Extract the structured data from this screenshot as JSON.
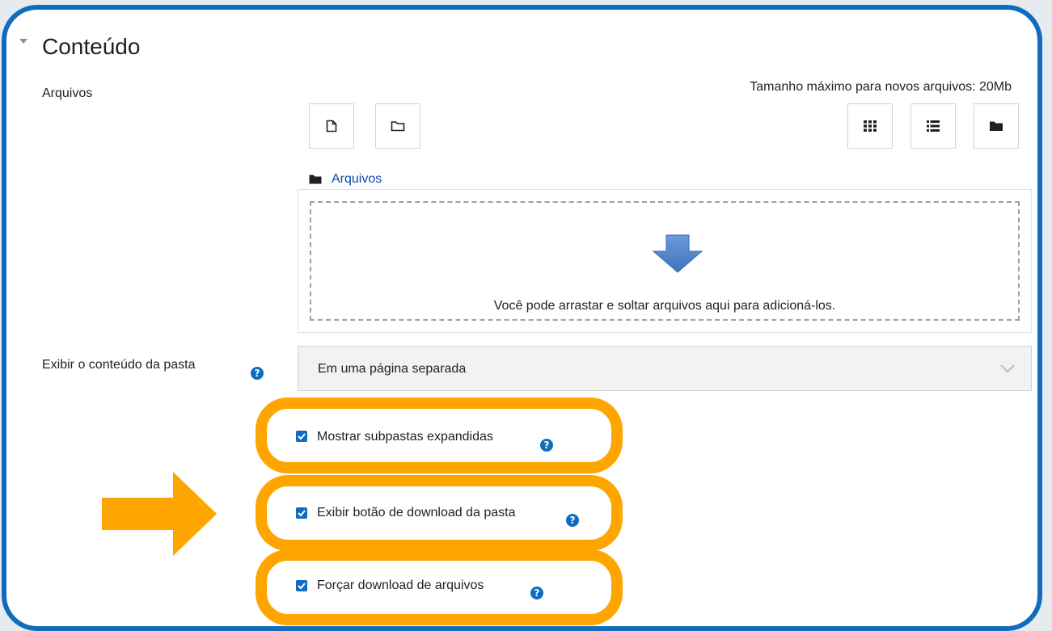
{
  "section": {
    "title": "Conteúdo"
  },
  "files": {
    "label": "Arquivos",
    "max_size": "Tamanho máximo para novos arquivos: 20Mb",
    "path_label": "Arquivos",
    "drop_text": "Você pode arrastar e soltar arquivos aqui para adicioná-los."
  },
  "display": {
    "label": "Exibir o conteúdo da pasta",
    "selected": "Em uma página separada",
    "help_glyph": "?"
  },
  "options": [
    {
      "label": "Mostrar subpastas expandidas",
      "checked": true
    },
    {
      "label": "Exibir botão de download da pasta",
      "checked": true
    },
    {
      "label": "Forçar download de arquivos",
      "checked": true
    }
  ],
  "colors": {
    "accent": "#0f6cbf",
    "highlight": "#ffa500",
    "drop_arrow": "#4f81c9"
  },
  "icons": {
    "add_file": "add-file-icon",
    "create_folder": "create-folder-icon",
    "view_icons": "grid-view-icon",
    "view_list": "list-view-icon",
    "view_tree": "folder-tree-icon"
  }
}
